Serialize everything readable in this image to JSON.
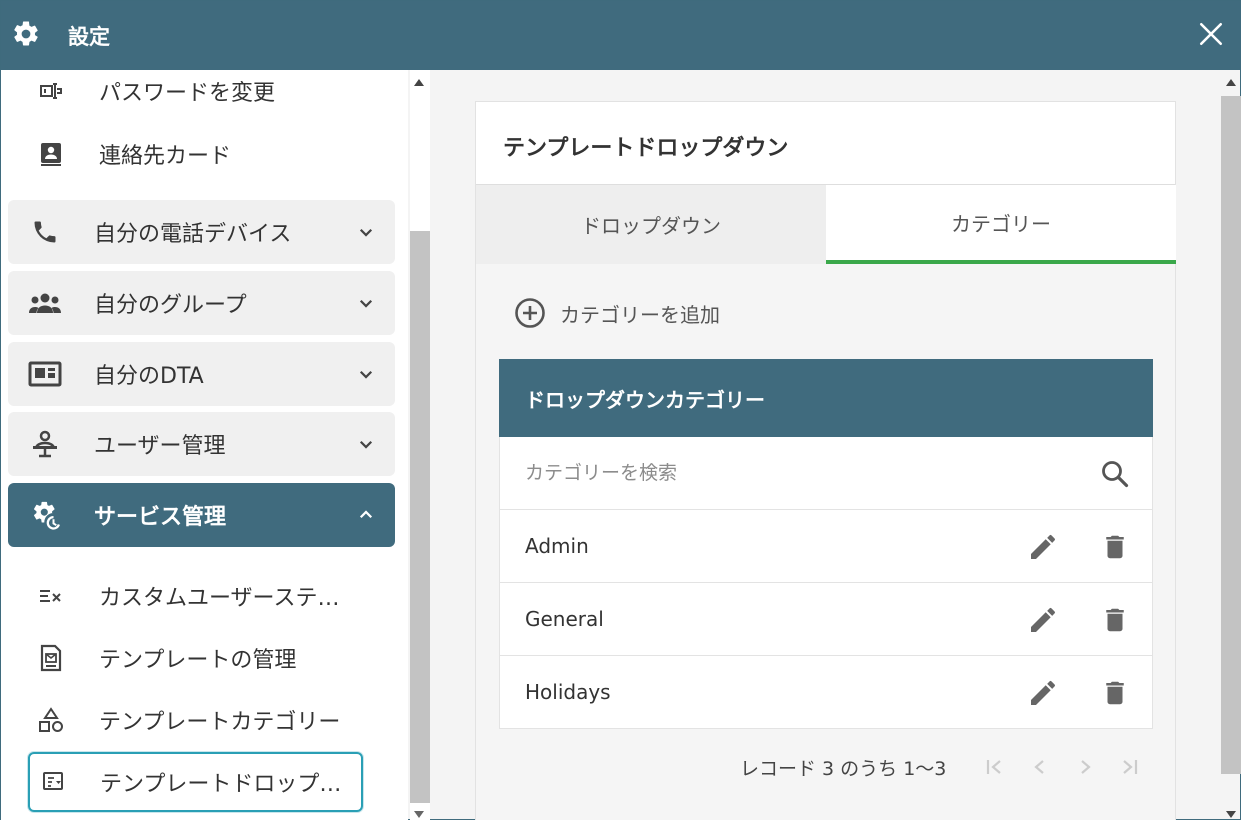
{
  "window": {
    "title": "設定",
    "gear_icon": "gear-icon",
    "close_icon": "close-icon"
  },
  "colors": {
    "primary": "#406b7e",
    "tab_indicator": "#3aa84a",
    "selected_border": "#2a9fb5"
  },
  "sidebar": {
    "top_items": [
      {
        "label": "パスワードを変更",
        "icon": "password-icon"
      },
      {
        "label": "連絡先カード",
        "icon": "contact-card-icon"
      }
    ],
    "groups": [
      {
        "label": "自分の電話デバイス",
        "icon": "phone-icon",
        "expanded": false
      },
      {
        "label": "自分のグループ",
        "icon": "group-icon",
        "expanded": false
      },
      {
        "label": "自分のDTA",
        "icon": "dta-icon",
        "expanded": false
      },
      {
        "label": "ユーザー管理",
        "icon": "user-management-icon",
        "expanded": false
      },
      {
        "label": "サービス管理",
        "icon": "service-gear-icon",
        "expanded": true
      }
    ],
    "sub_items": [
      {
        "label": "カスタムユーザーステ…",
        "icon": "custom-status-icon"
      },
      {
        "label": "テンプレートの管理",
        "icon": "template-icon"
      },
      {
        "label": "テンプレートカテゴリー",
        "icon": "shapes-icon"
      },
      {
        "label": "テンプレートドロップ…",
        "icon": "dropdown-template-icon",
        "selected": true
      }
    ]
  },
  "main": {
    "title": "テンプレートドロップダウン",
    "tabs": [
      {
        "label": "ドロップダウン",
        "active": false
      },
      {
        "label": "カテゴリー",
        "active": true
      }
    ],
    "add_button_label": "カテゴリーを追加",
    "table": {
      "header": "ドロップダウンカテゴリー",
      "search_placeholder": "カテゴリーを検索",
      "rows": [
        {
          "name": "Admin"
        },
        {
          "name": "General"
        },
        {
          "name": "Holidays"
        }
      ]
    },
    "pagination": {
      "info": "レコード 3 のうち 1～3"
    }
  }
}
